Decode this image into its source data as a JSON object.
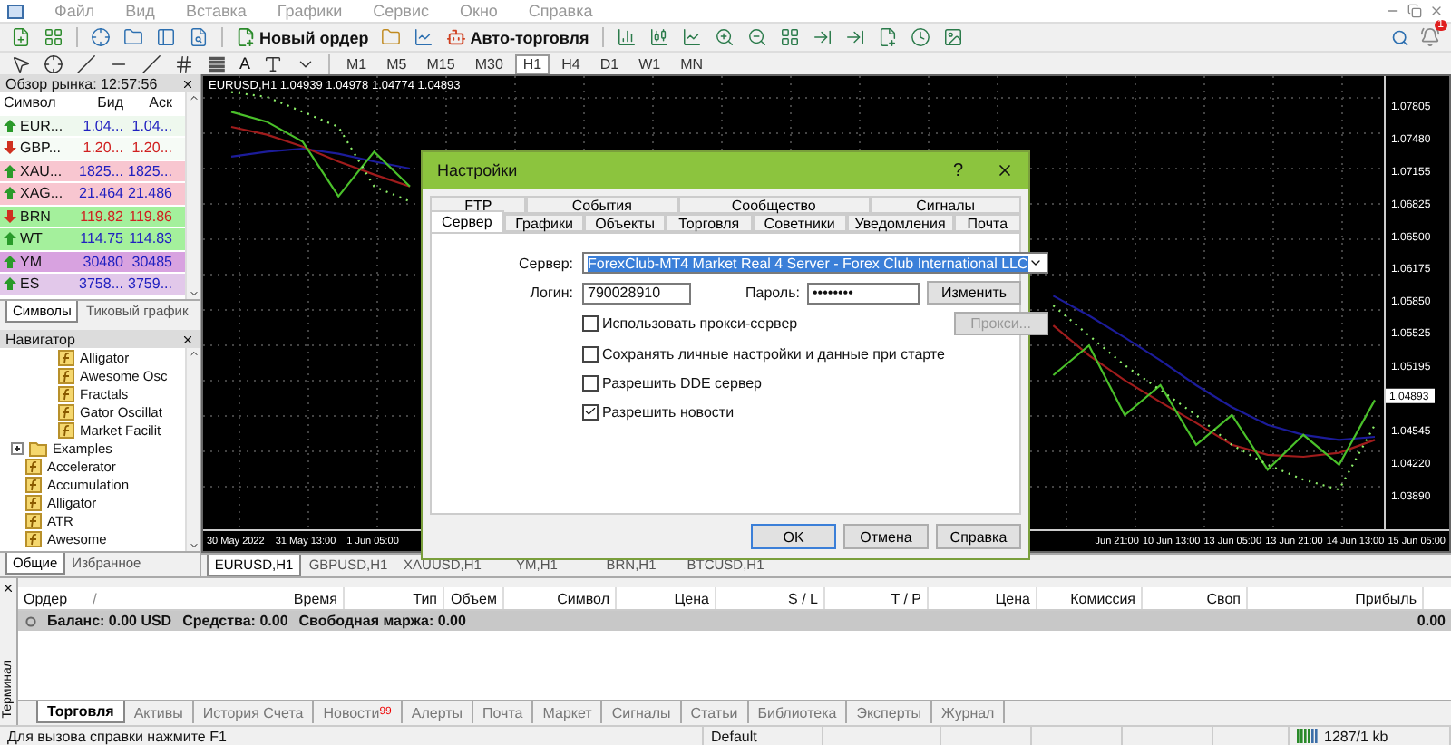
{
  "menu": [
    "Файл",
    "Вид",
    "Вставка",
    "Графики",
    "Сервис",
    "Окно",
    "Справка"
  ],
  "toolbar": {
    "new_order": "Новый ордер",
    "auto_trading": "Авто-торговля"
  },
  "drawing_toolbar": {
    "text_tool": "A",
    "timeframes": [
      {
        "label": "M1",
        "selected": false
      },
      {
        "label": "M5",
        "selected": false
      },
      {
        "label": "M15",
        "selected": false
      },
      {
        "label": "M30",
        "selected": false
      },
      {
        "label": "H1",
        "selected": true
      },
      {
        "label": "H4",
        "selected": false
      },
      {
        "label": "D1",
        "selected": false
      },
      {
        "label": "W1",
        "selected": false
      },
      {
        "label": "MN",
        "selected": false
      }
    ]
  },
  "notifications": {
    "badge": "1"
  },
  "market_watch": {
    "title": "Обзор рынка: 12:57:56",
    "columns": [
      "Символ",
      "Бид",
      "Аск"
    ],
    "rows": [
      {
        "symbol": "EUR...",
        "bid": "1.04...",
        "ask": "1.04...",
        "kind": "up",
        "color": "#eef8ee"
      },
      {
        "symbol": "GBP...",
        "bid": "1.20...",
        "ask": "1.20...",
        "kind": "down",
        "color": "#f6fbf6"
      },
      {
        "symbol": "XAU...",
        "bid": "1825...",
        "ask": "1825...",
        "kind": "up",
        "color": "#f8c6d0"
      },
      {
        "symbol": "XAG...",
        "bid": "21.464",
        "ask": "21.486",
        "kind": "up",
        "color": "#f8c6d0"
      },
      {
        "symbol": "BRN",
        "bid": "119.82",
        "ask": "119.86",
        "kind": "down",
        "color": "#a4f09c"
      },
      {
        "symbol": "WT",
        "bid": "114.75",
        "ask": "114.83",
        "kind": "up",
        "color": "#a4f09c"
      },
      {
        "symbol": "YM",
        "bid": "30480",
        "ask": "30485",
        "kind": "up",
        "color": "#d8a2e0"
      },
      {
        "symbol": "ES",
        "bid": "3758...",
        "ask": "3759...",
        "kind": "up",
        "color": "#e2c8ea"
      }
    ],
    "tabs": [
      {
        "label": "Символы",
        "selected": true
      },
      {
        "label": "Тиковый график",
        "selected": false
      }
    ]
  },
  "navigator": {
    "title": "Навигатор",
    "tree": [
      {
        "kind": "group",
        "children": [
          {
            "kind": "indicator",
            "label": "Alligator"
          },
          {
            "kind": "indicator",
            "label": "Awesome Osc"
          },
          {
            "kind": "indicator",
            "label": "Fractals"
          },
          {
            "kind": "indicator",
            "label": "Gator Oscillat"
          },
          {
            "kind": "indicator",
            "label": "Market Facilit"
          }
        ]
      },
      {
        "kind": "folder",
        "label": "Examples",
        "expanded": false
      },
      {
        "kind": "indicator",
        "label": "Accelerator"
      },
      {
        "kind": "indicator",
        "label": "Accumulation"
      },
      {
        "kind": "indicator",
        "label": "Alligator"
      },
      {
        "kind": "indicator",
        "label": "ATR"
      },
      {
        "kind": "indicator",
        "label": "Awesome"
      }
    ],
    "tabs": [
      {
        "label": "Общие",
        "selected": true
      },
      {
        "label": "Избранное",
        "selected": false
      }
    ]
  },
  "chart": {
    "header": "EURUSD,H1  1.04939 1.04978 1.04774 1.04893",
    "chart_data": {
      "type": "line",
      "grid": true,
      "ylim": [
        1.0355,
        1.0811
      ],
      "yticks": [
        {
          "value": 1.07805,
          "label": "1.07805"
        },
        {
          "value": 1.0748,
          "label": "1.07480"
        },
        {
          "value": 1.07155,
          "label": "1.07155"
        },
        {
          "value": 1.06825,
          "label": "1.06825"
        },
        {
          "value": 1.065,
          "label": "1.06500"
        },
        {
          "value": 1.06175,
          "label": "1.06175"
        },
        {
          "value": 1.0585,
          "label": "1.05850"
        },
        {
          "value": 1.05525,
          "label": "1.05525"
        },
        {
          "value": 1.05195,
          "label": "1.05195"
        },
        {
          "value": 1.04545,
          "label": "1.04545"
        },
        {
          "value": 1.0422,
          "label": "1.04220"
        },
        {
          "value": 1.0389,
          "label": "1.03890"
        }
      ],
      "series": [
        {
          "color": "#1c1c9a",
          "values": [
            1.073,
            1.0735,
            1.0738,
            1.0733,
            1.0725,
            1.0718,
            null,
            null,
            null,
            null,
            null,
            null,
            null,
            null,
            null,
            null,
            null,
            null,
            null,
            null,
            null,
            null,
            null,
            1.059,
            1.057,
            1.0548,
            1.0525,
            1.05,
            1.0478,
            1.046,
            1.045,
            1.0445,
            1.0448
          ]
        },
        {
          "color": "#a01c1c",
          "values": [
            1.076,
            1.0752,
            1.074,
            1.0725,
            1.0712,
            1.07,
            null,
            null,
            null,
            null,
            null,
            null,
            null,
            null,
            null,
            null,
            null,
            null,
            null,
            null,
            null,
            null,
            null,
            1.056,
            1.053,
            1.0505,
            1.0483,
            1.0462,
            1.044,
            1.043,
            1.0428,
            1.0432,
            1.0445
          ]
        },
        {
          "color": "#4ac02a",
          "values": [
            1.0775,
            1.0765,
            1.0745,
            1.069,
            1.0735,
            1.07,
            null,
            null,
            null,
            null,
            null,
            null,
            null,
            null,
            null,
            null,
            null,
            null,
            null,
            null,
            null,
            null,
            null,
            1.051,
            1.054,
            1.047,
            1.05,
            1.044,
            1.047,
            1.0415,
            1.045,
            1.042,
            1.0485
          ]
        },
        {
          "color": "#8ef06a",
          "line_style": "dotted",
          "values": [
            1.0795,
            1.079,
            1.0775,
            1.076,
            1.07,
            1.0685,
            null,
            null,
            null,
            null,
            null,
            null,
            null,
            null,
            null,
            null,
            null,
            null,
            null,
            null,
            null,
            null,
            null,
            1.058,
            1.055,
            1.052,
            1.0495,
            1.047,
            1.044,
            1.042,
            1.0405,
            1.0395,
            1.046
          ]
        }
      ]
    },
    "current_price": "1.04893",
    "time_labels_left": [
      "30 May 2022",
      "31 May 13:00",
      "1 Jun 05:00"
    ],
    "time_labels_right": [
      "Jun 21:00",
      "10 Jun 13:00",
      "13 Jun 05:00",
      "13 Jun 21:00",
      "14 Jun 13:00",
      "15 Jun 05:00"
    ]
  },
  "chart_tabs": [
    {
      "label": "EURUSD,H1",
      "selected": true
    },
    {
      "label": "GBPUSD,H1",
      "selected": false
    },
    {
      "label": "XAUUSD,H1",
      "selected": false
    },
    {
      "label": "YM,H1",
      "selected": false
    },
    {
      "label": "BRN,H1",
      "selected": false
    },
    {
      "label": "BTCUSD,H1",
      "selected": false
    }
  ],
  "dialog": {
    "title": "Настройки",
    "help": "?",
    "tab_rows": [
      [
        {
          "label": "FTP",
          "selected": false
        },
        {
          "label": "События",
          "selected": false
        },
        {
          "label": "Сообщество",
          "selected": false
        },
        {
          "label": "Сигналы",
          "selected": false
        }
      ],
      [
        {
          "label": "Сервер",
          "selected": true
        },
        {
          "label": "Графики",
          "selected": false
        },
        {
          "label": "Объекты",
          "selected": false
        },
        {
          "label": "Торговля",
          "selected": false
        },
        {
          "label": "Советники",
          "selected": false
        },
        {
          "label": "Уведомления",
          "selected": false
        },
        {
          "label": "Почта",
          "selected": false
        }
      ]
    ],
    "server_label": "Сервер:",
    "server": "ForexClub-MT4 Market Real 4 Server - Forex Club International LLC",
    "login_label": "Логин:",
    "login": "790028910",
    "password_label": "Пароль:",
    "password": "••••••••",
    "change_button": "Изменить",
    "proxy_button": {
      "label": "Прокси...",
      "disabled": true
    },
    "checkboxes": [
      {
        "label": "Использовать прокси-сервер",
        "checked": false
      },
      {
        "label": "Сохранять личные настройки и данные при старте",
        "checked": false
      },
      {
        "label": "Разрешить DDE сервер",
        "checked": false
      },
      {
        "label": "Разрешить новости",
        "checked": true
      }
    ],
    "buttons": [
      {
        "label": "OK",
        "default": true
      },
      {
        "label": "Отмена",
        "default": false
      },
      {
        "label": "Справка",
        "default": false
      }
    ]
  },
  "terminal": {
    "title": "Терминал",
    "sort_mark": "/",
    "columns": [
      "Ордер",
      "Время",
      "Тип",
      "Объем",
      "Символ",
      "Цена",
      "S / L",
      "T / P",
      "Цена",
      "Комиссия",
      "Своп",
      "Прибыль"
    ],
    "balance": [
      "Баланс: 0.00 USD",
      "Средства: 0.00",
      "Свободная маржа: 0.00"
    ],
    "profit": "0.00",
    "tabs": [
      {
        "label": "Торговля",
        "selected": true
      },
      {
        "label": "Активы",
        "selected": false
      },
      {
        "label": "История Счета",
        "selected": false
      },
      {
        "label": "Новости",
        "selected": false,
        "badge": "99"
      },
      {
        "label": "Алерты",
        "selected": false
      },
      {
        "label": "Почта",
        "selected": false
      },
      {
        "label": "Маркет",
        "selected": false
      },
      {
        "label": "Сигналы",
        "selected": false
      },
      {
        "label": "Статьи",
        "selected": false
      },
      {
        "label": "Библиотека",
        "selected": false
      },
      {
        "label": "Эксперты",
        "selected": false
      },
      {
        "label": "Журнал",
        "selected": false
      }
    ]
  },
  "status_bar": {
    "hint": "Для вызова справки нажмите F1",
    "profile": "Default",
    "traffic": "1287/1 kb"
  }
}
